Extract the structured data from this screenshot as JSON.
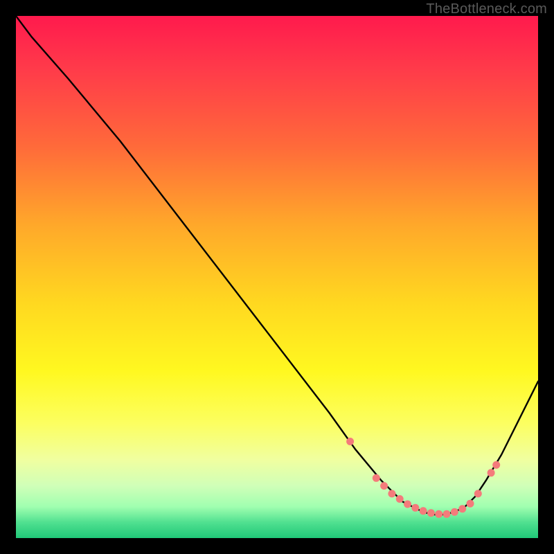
{
  "watermark": "TheBottleneck.com",
  "chart_data": {
    "type": "line",
    "title": "",
    "xlabel": "",
    "ylabel": "",
    "xlim": [
      0,
      100
    ],
    "ylim": [
      0,
      100
    ],
    "series": [
      {
        "name": "bottleneck-curve",
        "x": [
          0,
          3,
          10,
          20,
          30,
          40,
          50,
          60,
          65,
          70,
          74,
          76,
          78,
          80,
          82,
          84,
          86,
          88,
          90,
          93,
          100
        ],
        "y": [
          100,
          96,
          88,
          76,
          63,
          50,
          37,
          24,
          17,
          11,
          7,
          6,
          5,
          4.5,
          4.5,
          5,
          6,
          8,
          11,
          16,
          30
        ]
      }
    ],
    "markers": {
      "name": "highlight-dots",
      "color": "#f47b7b",
      "points": [
        {
          "x": 64,
          "y": 18.5
        },
        {
          "x": 69,
          "y": 11.5
        },
        {
          "x": 70.5,
          "y": 10
        },
        {
          "x": 72,
          "y": 8.5
        },
        {
          "x": 73.5,
          "y": 7.5
        },
        {
          "x": 75,
          "y": 6.5
        },
        {
          "x": 76.5,
          "y": 5.8
        },
        {
          "x": 78,
          "y": 5.2
        },
        {
          "x": 79.5,
          "y": 4.8
        },
        {
          "x": 81,
          "y": 4.6
        },
        {
          "x": 82.5,
          "y": 4.6
        },
        {
          "x": 84,
          "y": 5
        },
        {
          "x": 85.5,
          "y": 5.6
        },
        {
          "x": 87,
          "y": 6.6
        },
        {
          "x": 88.5,
          "y": 8.5
        },
        {
          "x": 91,
          "y": 12.5
        },
        {
          "x": 92,
          "y": 14
        }
      ]
    },
    "gradient_stops": [
      {
        "pos": 0.0,
        "label": "red",
        "color": "#ff1a4d"
      },
      {
        "pos": 0.5,
        "label": "yellow",
        "color": "#fff028"
      },
      {
        "pos": 1.0,
        "label": "green",
        "color": "#20c878"
      }
    ]
  }
}
